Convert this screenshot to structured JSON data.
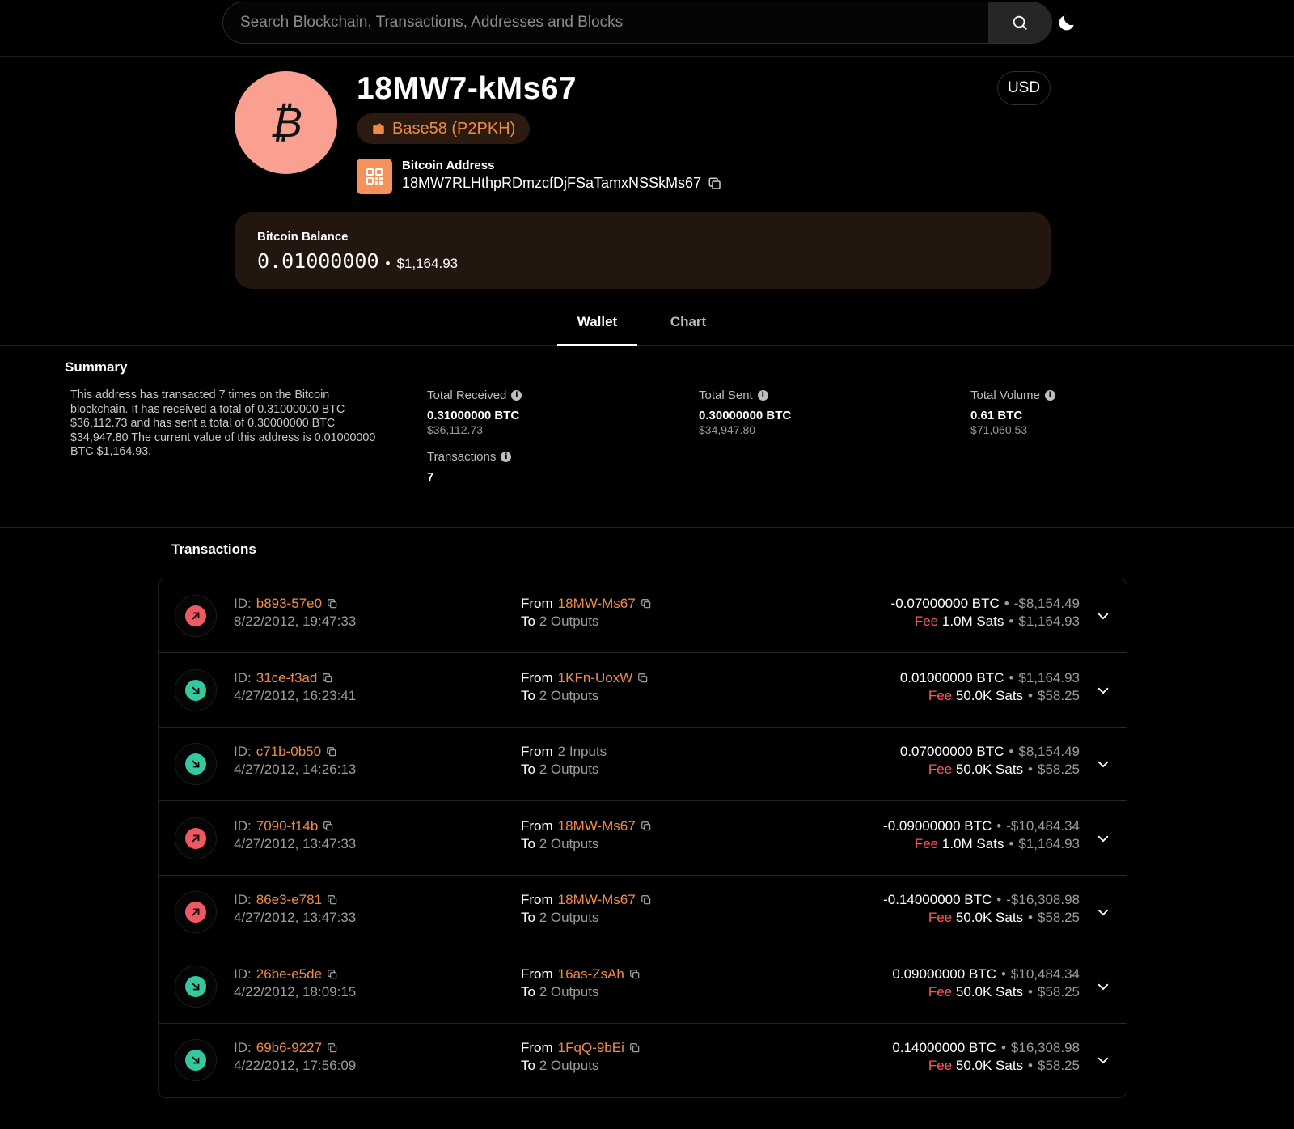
{
  "search": {
    "placeholder": "Search Blockchain, Transactions, Addresses and Blocks"
  },
  "header": {
    "title": "18MW7-kMs67",
    "address_type": "Base58 (P2PKH)",
    "address_label": "Bitcoin Address",
    "address_full": "18MW7RLHthpRDmzcfDjFSaTamxNSSkMs67",
    "currency": "USD",
    "avatar_symbol": "₿"
  },
  "balance": {
    "label": "Bitcoin Balance",
    "btc": "0.01000000",
    "usd": "$1,164.93"
  },
  "tabs": [
    {
      "label": "Wallet",
      "active": true
    },
    {
      "label": "Chart",
      "active": false
    }
  ],
  "summary": {
    "title": "Summary",
    "description": "This address has transacted 7 times on the Bitcoin blockchain. It has received a total of 0.31000000 BTC $36,112.73 and has sent a total of 0.30000000 BTC $34,947.80 The current value of this address is 0.01000000 BTC $1,164.93.",
    "stats": [
      {
        "label": "Total Received",
        "main": "0.31000000 BTC",
        "sub": "$36,112.73"
      },
      {
        "label": "Total Sent",
        "main": "0.30000000 BTC",
        "sub": "$34,947.80"
      },
      {
        "label": "Total Volume",
        "main": "0.61 BTC",
        "sub": "$71,060.53"
      },
      {
        "label": "Transactions",
        "main": "7",
        "sub": ""
      }
    ]
  },
  "transactions": {
    "title": "Transactions",
    "id_prefix": "ID:",
    "from_label": "From",
    "to_label": "To",
    "fee_label": "Fee",
    "rows": [
      {
        "direction": "out",
        "id": "b893-57e0",
        "date": "8/22/2012, 19:47:33",
        "from": "18MW-Ms67",
        "from_is_link": true,
        "to": "2 Outputs",
        "amount_btc": "-0.07000000 BTC",
        "amount_usd": "-$8,154.49",
        "fee_sats": "1.0M Sats",
        "fee_usd": "$1,164.93"
      },
      {
        "direction": "in",
        "id": "31ce-f3ad",
        "date": "4/27/2012, 16:23:41",
        "from": "1KFn-UoxW",
        "from_is_link": true,
        "to": "2 Outputs",
        "amount_btc": "0.01000000 BTC",
        "amount_usd": "$1,164.93",
        "fee_sats": "50.0K Sats",
        "fee_usd": "$58.25"
      },
      {
        "direction": "in",
        "id": "c71b-0b50",
        "date": "4/27/2012, 14:26:13",
        "from": "2 Inputs",
        "from_is_link": false,
        "to": "2 Outputs",
        "amount_btc": "0.07000000 BTC",
        "amount_usd": "$8,154.49",
        "fee_sats": "50.0K Sats",
        "fee_usd": "$58.25"
      },
      {
        "direction": "out",
        "id": "7090-f14b",
        "date": "4/27/2012, 13:47:33",
        "from": "18MW-Ms67",
        "from_is_link": true,
        "to": "2 Outputs",
        "amount_btc": "-0.09000000 BTC",
        "amount_usd": "-$10,484.34",
        "fee_sats": "1.0M Sats",
        "fee_usd": "$1,164.93"
      },
      {
        "direction": "out",
        "id": "86e3-e781",
        "date": "4/27/2012, 13:47:33",
        "from": "18MW-Ms67",
        "from_is_link": true,
        "to": "2 Outputs",
        "amount_btc": "-0.14000000 BTC",
        "amount_usd": "-$16,308.98",
        "fee_sats": "50.0K Sats",
        "fee_usd": "$58.25"
      },
      {
        "direction": "in",
        "id": "26be-e5de",
        "date": "4/22/2012, 18:09:15",
        "from": "16as-ZsAh",
        "from_is_link": true,
        "to": "2 Outputs",
        "amount_btc": "0.09000000 BTC",
        "amount_usd": "$10,484.34",
        "fee_sats": "50.0K Sats",
        "fee_usd": "$58.25"
      },
      {
        "direction": "in",
        "id": "69b6-9227",
        "date": "4/22/2012, 17:56:09",
        "from": "1FqQ-9bEi",
        "from_is_link": true,
        "to": "2 Outputs",
        "amount_btc": "0.14000000 BTC",
        "amount_usd": "$16,308.98",
        "fee_sats": "50.0K Sats",
        "fee_usd": "$58.25"
      }
    ]
  },
  "colors": {
    "accent": "#f08a4b",
    "out": "#ef5a62",
    "in": "#36c9a0",
    "fee": "#ff5757",
    "avatar": "#f9a090",
    "balance_bg": "#22160e"
  }
}
